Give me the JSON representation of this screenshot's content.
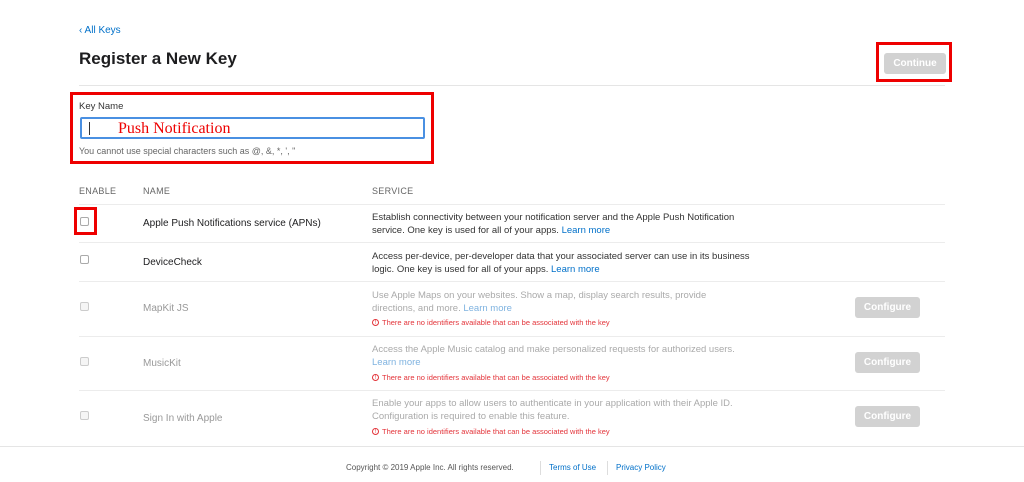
{
  "nav": {
    "back_link": "‹ All Keys"
  },
  "header": {
    "title": "Register a New Key",
    "continue_label": "Continue"
  },
  "key_name": {
    "label": "Key Name",
    "value": "Push Notification",
    "hint": "You cannot use special characters such as @, &, *, ', \""
  },
  "table": {
    "headers": [
      "ENABLE",
      "NAME",
      "SERVICE"
    ],
    "rows": [
      {
        "name": "Apple Push Notifications service (APNs)",
        "desc": "Establish connectivity between your notification server and the Apple Push Notification service. One key is used for all of your apps.",
        "learn_more": "Learn more"
      },
      {
        "name": "DeviceCheck",
        "desc": "Access per-device, per-developer data that your associated server can use in its business logic. One key is used for all of your apps.",
        "learn_more": "Learn more"
      },
      {
        "name": "MapKit JS",
        "desc": "Use Apple Maps on your websites. Show a map, display search results, provide directions, and more.",
        "learn_more": "Learn more",
        "warning": "There are no identifiers available that can be associated with the key",
        "configure": "Configure"
      },
      {
        "name": "MusicKit",
        "desc": "Access the Apple Music catalog and make personalized requests for authorized users.",
        "learn_more": "Learn more",
        "warning": "There are no identifiers available that can be associated with the key",
        "configure": "Configure"
      },
      {
        "name": "Sign In with Apple",
        "desc": "Enable your apps to allow users to authenticate in your application with their Apple ID. Configuration is required to enable this feature.",
        "warning": "There are no identifiers available that can be associated with the key",
        "configure": "Configure"
      }
    ]
  },
  "footer": {
    "copyright": "Copyright © 2019 Apple Inc. All rights reserved.",
    "terms": "Terms of Use",
    "privacy": "Privacy Policy"
  },
  "colors": {
    "highlight": "#e00000",
    "link": "#0070c9",
    "disabled_button": "#d2d2d2",
    "warning": "#e3343a"
  }
}
